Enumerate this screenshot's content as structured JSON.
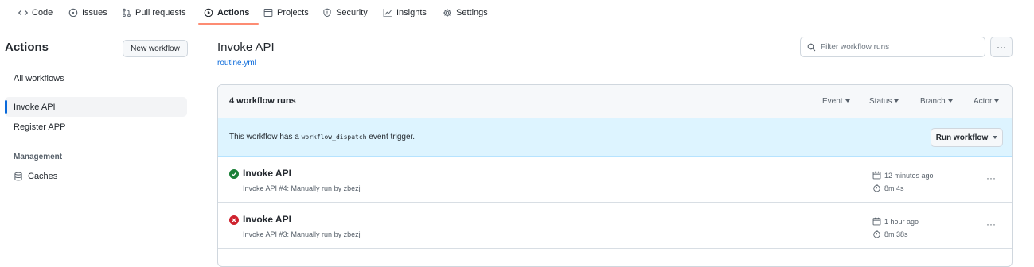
{
  "nav": {
    "tabs": [
      {
        "label": "Code",
        "icon": "code-icon"
      },
      {
        "label": "Issues",
        "icon": "issue-icon"
      },
      {
        "label": "Pull requests",
        "icon": "pull-request-icon"
      },
      {
        "label": "Actions",
        "icon": "play-icon",
        "active": true
      },
      {
        "label": "Projects",
        "icon": "table-icon"
      },
      {
        "label": "Security",
        "icon": "shield-icon"
      },
      {
        "label": "Insights",
        "icon": "graph-icon"
      },
      {
        "label": "Settings",
        "icon": "gear-icon"
      }
    ],
    "active_underline_color": "#fd8c73"
  },
  "sidebar": {
    "title": "Actions",
    "new_workflow_label": "New workflow",
    "all_workflows": "All workflows",
    "workflows": [
      {
        "label": "Invoke API",
        "active": true
      },
      {
        "label": "Register APP",
        "active": false
      }
    ],
    "management_heading": "Management",
    "caches_label": "Caches"
  },
  "main": {
    "title": "Invoke API",
    "file": "routine.yml",
    "filter_placeholder": "Filter workflow runs",
    "more_label": "···",
    "runs_count": "4 workflow runs",
    "filters": [
      "Event",
      "Status",
      "Branch",
      "Actor"
    ],
    "notice_prefix": "This workflow has a",
    "notice_code": "workflow_dispatch",
    "notice_suffix": "event trigger.",
    "run_workflow_label": "Run workflow",
    "runs": [
      {
        "status": "success",
        "title": "Invoke API",
        "subtitle": "Invoke API #4: Manually run by zbezj",
        "time": "12 minutes ago",
        "duration": "8m 4s",
        "more": "···"
      },
      {
        "status": "failure",
        "title": "Invoke API",
        "subtitle": "Invoke API #3: Manually run by zbezj",
        "time": "1 hour ago",
        "duration": "8m 38s",
        "more": "···"
      }
    ]
  },
  "colors": {
    "accent_blue": "#0969da",
    "success": "#1a7f37",
    "failure": "#cf222e",
    "notice_bg": "#ddf4ff"
  }
}
